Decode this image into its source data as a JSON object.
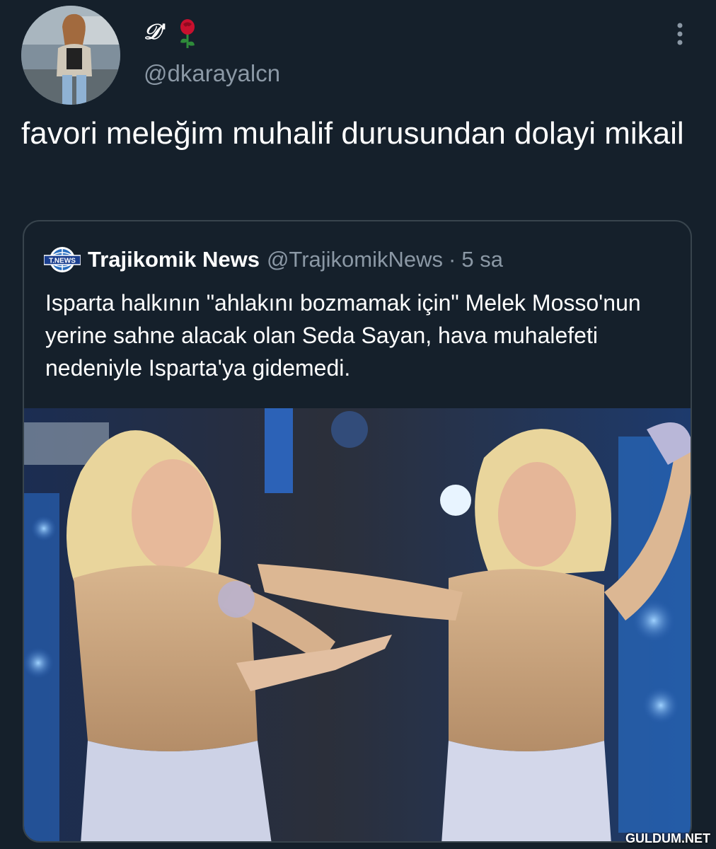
{
  "author": {
    "display_name": "𝒟'",
    "emoji": "rose-icon",
    "handle": "@dkarayalcn",
    "avatar": "user-avatar"
  },
  "tweet": {
    "text": "favori meleğim muhalif durusundan dolayi mikail",
    "more_icon": "more-vertical-icon"
  },
  "quote": {
    "logo_text": "T.NEWS",
    "name": "Trajikomik News",
    "handle": "@TrajikomikNews",
    "separator": "·",
    "time": "5 sa",
    "text": "Isparta halkının \"ahlakını bozmamak için\" Melek Mosso'nun yerine sahne alacak olan Seda Sayan, hava muhalefeti nedeniyle Isparta'ya gidemedi.",
    "media": "concert-photo"
  },
  "watermark": "GULDUM.NET",
  "colors": {
    "background": "#15202b",
    "border": "#38444d",
    "secondary_text": "#8b98a5",
    "primary_text": "#ffffff"
  }
}
